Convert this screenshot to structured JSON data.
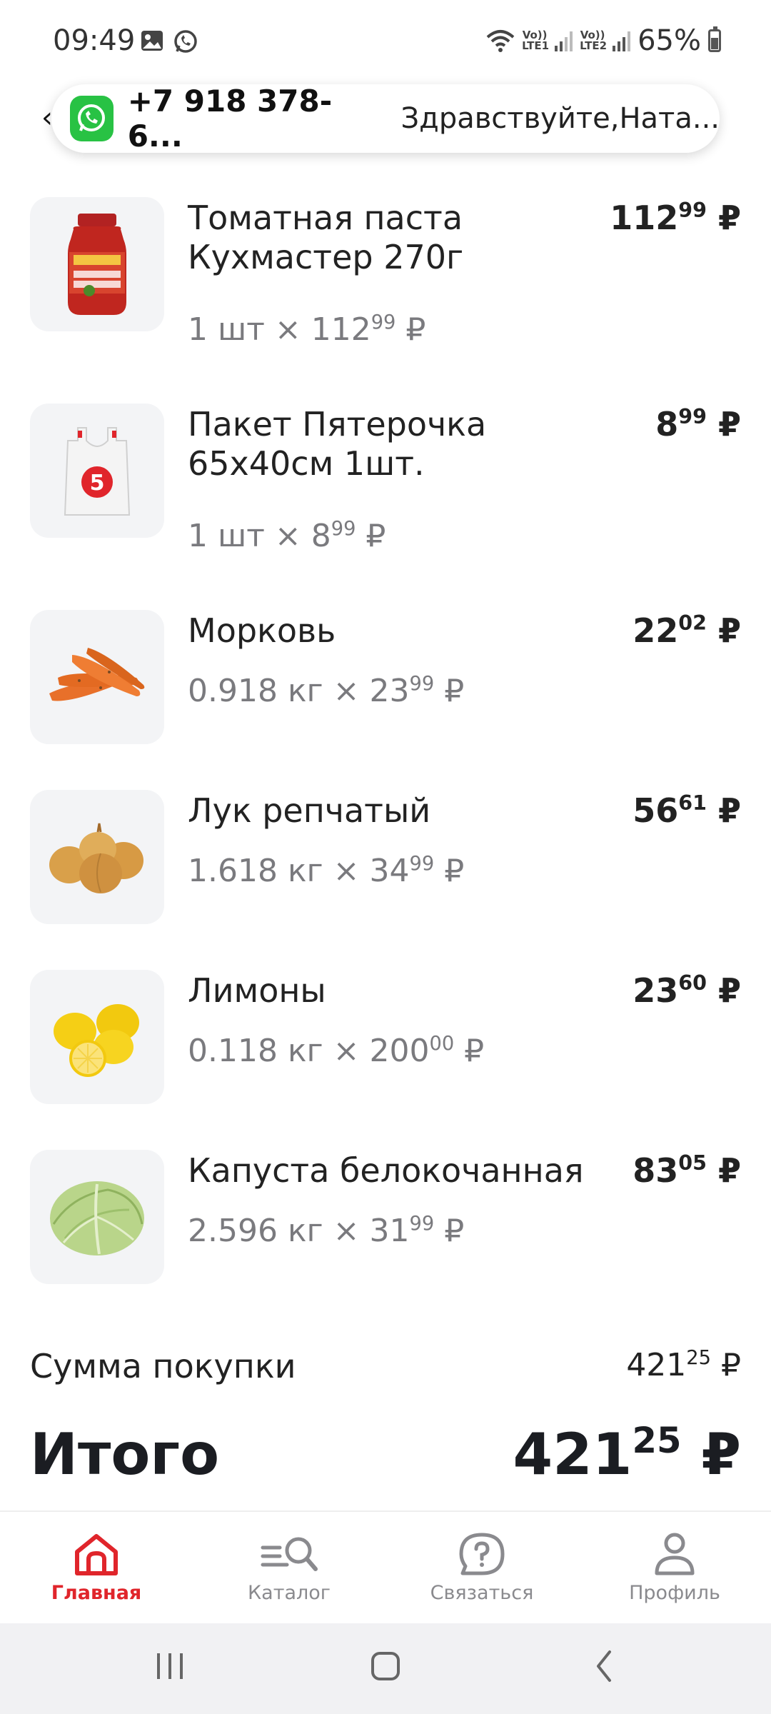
{
  "status_bar": {
    "time": "09:49",
    "lte1": "Vo)) LTE1",
    "lte2": "Vo)) LTE2",
    "battery": "65%"
  },
  "call_bar": {
    "phone": "+7 918 378-6...",
    "greeting": "Здравствуйте,Ната..."
  },
  "items": [
    {
      "name": "Томатная паста Кухмастер 270г",
      "qty": "1 шт × 112",
      "qty_cents": "99",
      "price_main": "112",
      "price_cents": "99",
      "currency": "₽"
    },
    {
      "name": "Пакет Пятерочка 65х40см 1шт.",
      "qty": "1 шт × 8",
      "qty_cents": "99",
      "price_main": "8",
      "price_cents": "99",
      "currency": "₽"
    },
    {
      "name": "Морковь",
      "qty": "0.918 кг × 23",
      "qty_cents": "99",
      "price_main": "22",
      "price_cents": "02",
      "currency": "₽"
    },
    {
      "name": "Лук репчатый",
      "qty": "1.618 кг × 34",
      "qty_cents": "99",
      "price_main": "56",
      "price_cents": "61",
      "currency": "₽"
    },
    {
      "name": "Лимоны",
      "qty": "0.118 кг × 200",
      "qty_cents": "00",
      "price_main": "23",
      "price_cents": "60",
      "currency": "₽"
    },
    {
      "name": "Капуста белокочанная",
      "qty": "2.596 кг × 31",
      "qty_cents": "99",
      "price_main": "83",
      "price_cents": "05",
      "currency": "₽"
    }
  ],
  "summary": {
    "sum_label": "Сумма покупки",
    "sum_main": "421",
    "sum_cents": "25",
    "total_label": "Итого",
    "total_main": "421",
    "total_cents": "25",
    "currency": "₽"
  },
  "nav": {
    "home": "Главная",
    "catalog": "Каталог",
    "contact": "Связаться",
    "profile": "Профиль"
  },
  "colors": {
    "accent": "#e0252b",
    "whatsapp": "#28c244",
    "muted": "#7a7a7e"
  }
}
